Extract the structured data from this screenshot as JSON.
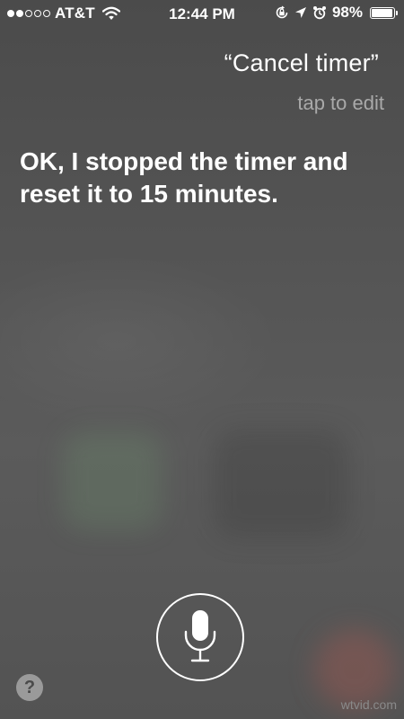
{
  "status_bar": {
    "signal": {
      "filled": 2,
      "total": 5
    },
    "carrier": "AT&T",
    "time": "12:44 PM",
    "battery_percent": "98%",
    "battery_level": 0.98,
    "icons": [
      "wifi-icon",
      "orientation-lock-icon",
      "location-icon",
      "alarm-icon",
      "battery-icon"
    ]
  },
  "siri": {
    "query": "“Cancel timer”",
    "tap_to_edit": "tap to edit",
    "response": "OK, I stopped the timer and reset it to 15 minutes."
  },
  "controls": {
    "mic_icon": "microphone-icon",
    "help_label": "?"
  },
  "watermark": "wtvid.com",
  "colors": {
    "background": "#4f4f4f",
    "text": "#ffffff",
    "secondary_text": "#a9a9a9"
  }
}
